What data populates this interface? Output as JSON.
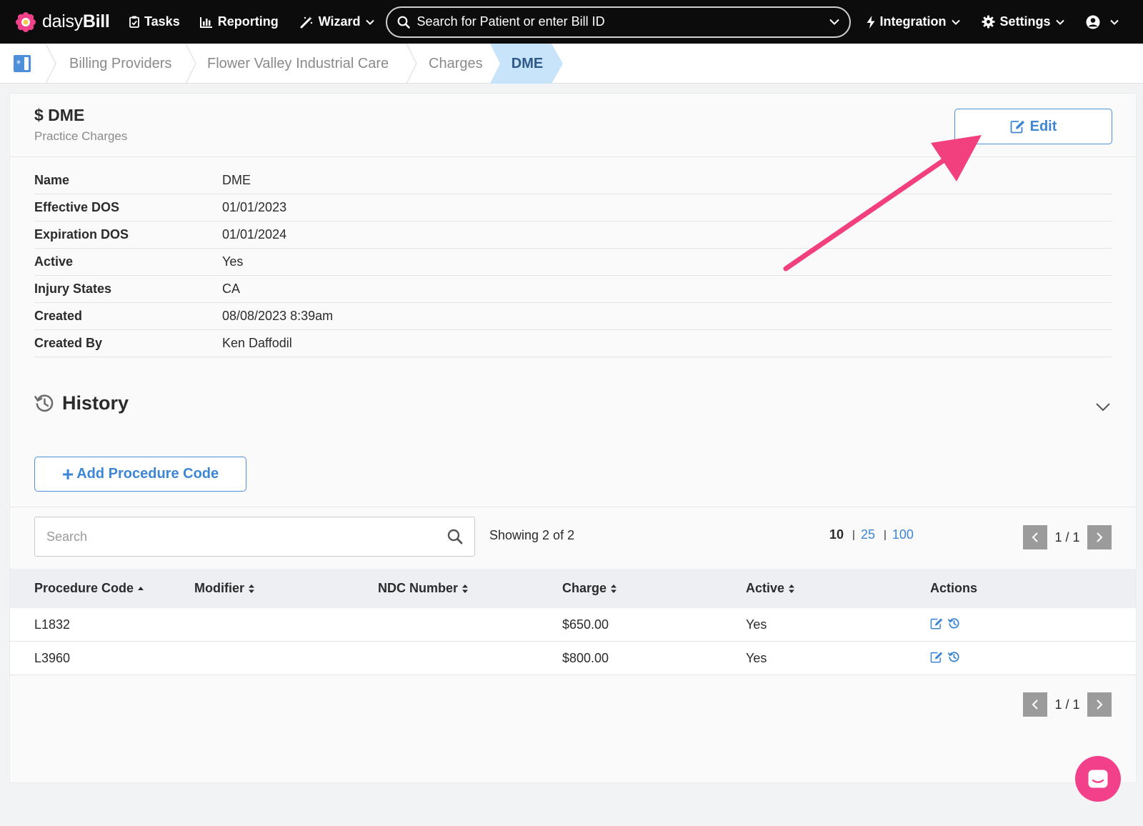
{
  "nav": {
    "logo_light": "daisy",
    "logo_bold": "Bill",
    "tasks": "Tasks",
    "reporting": "Reporting",
    "wizard": "Wizard",
    "search_placeholder": "Search for Patient or enter Bill ID",
    "integration": "Integration",
    "settings": "Settings"
  },
  "breadcrumb": {
    "items": [
      "Billing Providers",
      "Flower Valley Industrial Care",
      "Charges"
    ],
    "current": "DME"
  },
  "header": {
    "title": "$ DME",
    "subtitle": "Practice Charges",
    "edit_label": "Edit"
  },
  "details": [
    {
      "label": "Name",
      "value": "DME"
    },
    {
      "label": "Effective DOS",
      "value": "01/01/2023"
    },
    {
      "label": "Expiration DOS",
      "value": "01/01/2024"
    },
    {
      "label": "Active",
      "value": "Yes"
    },
    {
      "label": "Injury States",
      "value": "CA"
    },
    {
      "label": "Created",
      "value": "08/08/2023 8:39am"
    },
    {
      "label": "Created By",
      "value": "Ken Daffodil"
    }
  ],
  "history": {
    "title": "History"
  },
  "add_button": "Add Procedure Code",
  "table": {
    "search_placeholder": "Search",
    "showing": "Showing 2 of 2",
    "page_sizes": {
      "current": "10",
      "options": [
        "25",
        "100"
      ]
    },
    "pager": "1 / 1",
    "columns": [
      "Procedure Code",
      "Modifier",
      "NDC Number",
      "Charge",
      "Active",
      "Actions"
    ],
    "rows": [
      {
        "code": "L1832",
        "modifier": "",
        "ndc": "",
        "charge": "$650.00",
        "active": "Yes"
      },
      {
        "code": "L3960",
        "modifier": "",
        "ndc": "",
        "charge": "$800.00",
        "active": "Yes"
      }
    ]
  },
  "colors": {
    "accent": "#3d86d6",
    "annotation_arrow": "#f2407e",
    "chat": "#f2408a",
    "breadcrumb_active": "#c8e4fb"
  }
}
